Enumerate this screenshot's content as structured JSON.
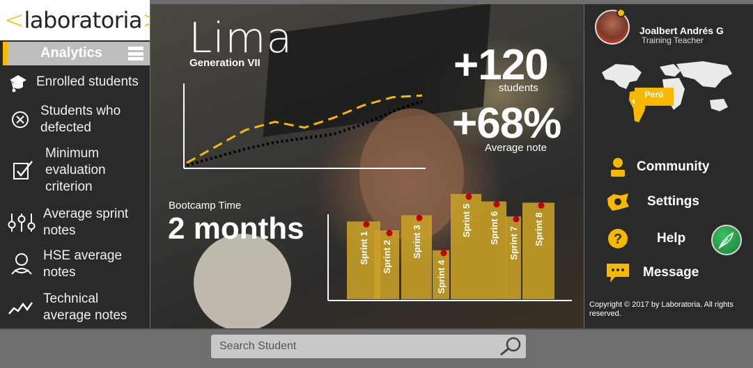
{
  "brand": {
    "logo_open": "<",
    "logo_word": "laboratoria",
    "logo_close": ">",
    "accent_color": "#f7b800"
  },
  "sidebar": {
    "section_label": "Analytics",
    "items": [
      {
        "label": "Enrolled students",
        "icon": "graduation-cap-icon"
      },
      {
        "label": "Students who defected",
        "icon": "x-circle-icon"
      },
      {
        "label": "Minimum evaluation criterion",
        "icon": "checkbox-icon"
      },
      {
        "label": "Average sprint notes",
        "icon": "sliders-icon"
      },
      {
        "label": "HSE average notes",
        "icon": "person-icon"
      },
      {
        "label": "Technical average notes",
        "icon": "trend-line-icon"
      }
    ]
  },
  "hero": {
    "city": "Lima",
    "generation": "Generation VII",
    "students_value": "+120",
    "students_label": "students",
    "average_value": "+68%",
    "average_label": "Average note",
    "bootcamp_label": "Bootcamp Time",
    "bootcamp_value": "2 months"
  },
  "chart_data": [
    {
      "type": "line",
      "title": "",
      "xlabel": "",
      "ylabel": "",
      "series": [
        {
          "style": "dashed",
          "color": "#f7b800",
          "x": [
            0,
            1,
            2,
            3,
            4,
            5,
            6,
            7,
            8
          ],
          "values": [
            0.05,
            0.25,
            0.45,
            0.55,
            0.48,
            0.6,
            0.75,
            0.85,
            0.87
          ]
        },
        {
          "style": "dotted",
          "color": "#000000",
          "x": [
            0,
            1,
            2,
            3,
            4,
            5,
            6,
            7,
            8
          ],
          "values": [
            0.02,
            0.12,
            0.22,
            0.3,
            0.35,
            0.4,
            0.52,
            0.68,
            0.8
          ]
        }
      ],
      "grid": false,
      "legend": "none"
    },
    {
      "type": "bar",
      "title": "",
      "categories": [
        "Sprint 1",
        "Sprint 2",
        "Sprint 3",
        "Sprint 4",
        "Sprint 5",
        "Sprint 6",
        "Sprint 7",
        "Sprint 8"
      ],
      "values": [
        62,
        55,
        67,
        39,
        84,
        78,
        66,
        77
      ],
      "ylim": [
        0,
        100
      ],
      "bar_color": "#c9a227",
      "marker_color": "#c00000",
      "grid": false,
      "legend": "none"
    }
  ],
  "right_panel": {
    "user_name": "Joalbert Andrés G",
    "user_role": "Training Teacher",
    "map_country": "Perú",
    "menu": [
      {
        "label": "Community",
        "icon": "person-icon"
      },
      {
        "label": "Settings",
        "icon": "gear-icon"
      },
      {
        "label": "Help",
        "icon": "question-icon"
      },
      {
        "label": "Message",
        "icon": "chat-bubble-icon"
      }
    ],
    "action_icon": "feather-icon",
    "copyright": "Copyright © 2017 by Laboratoria. All rights reserved."
  },
  "search": {
    "placeholder": "Search Student",
    "icon": "search-icon"
  }
}
